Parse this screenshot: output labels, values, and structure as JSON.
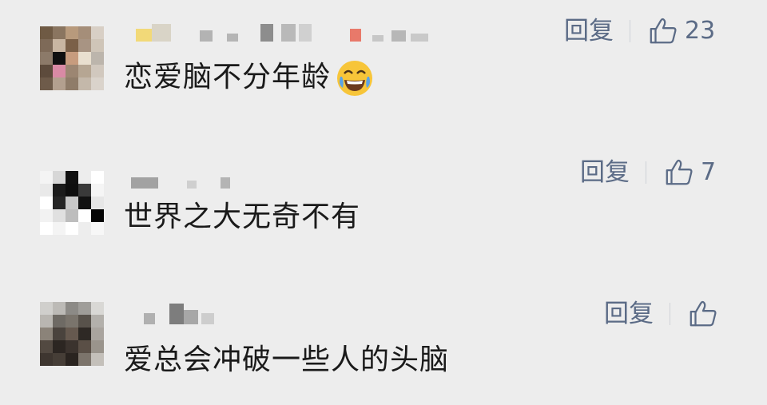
{
  "comments": [
    {
      "text": "恋爱脑不分年龄",
      "reply_label": "回复",
      "like_count": "23",
      "emoji": "face-with-tears-of-joy"
    },
    {
      "text": "世界之大无奇不有",
      "reply_label": "回复",
      "like_count": "7"
    },
    {
      "text": "爱总会冲破一些人的头脑",
      "reply_label": "回复",
      "like_count": ""
    }
  ],
  "colors": {
    "background": "#ededed",
    "action_text": "#5b6b86",
    "comment_text": "#1a1a1a"
  }
}
